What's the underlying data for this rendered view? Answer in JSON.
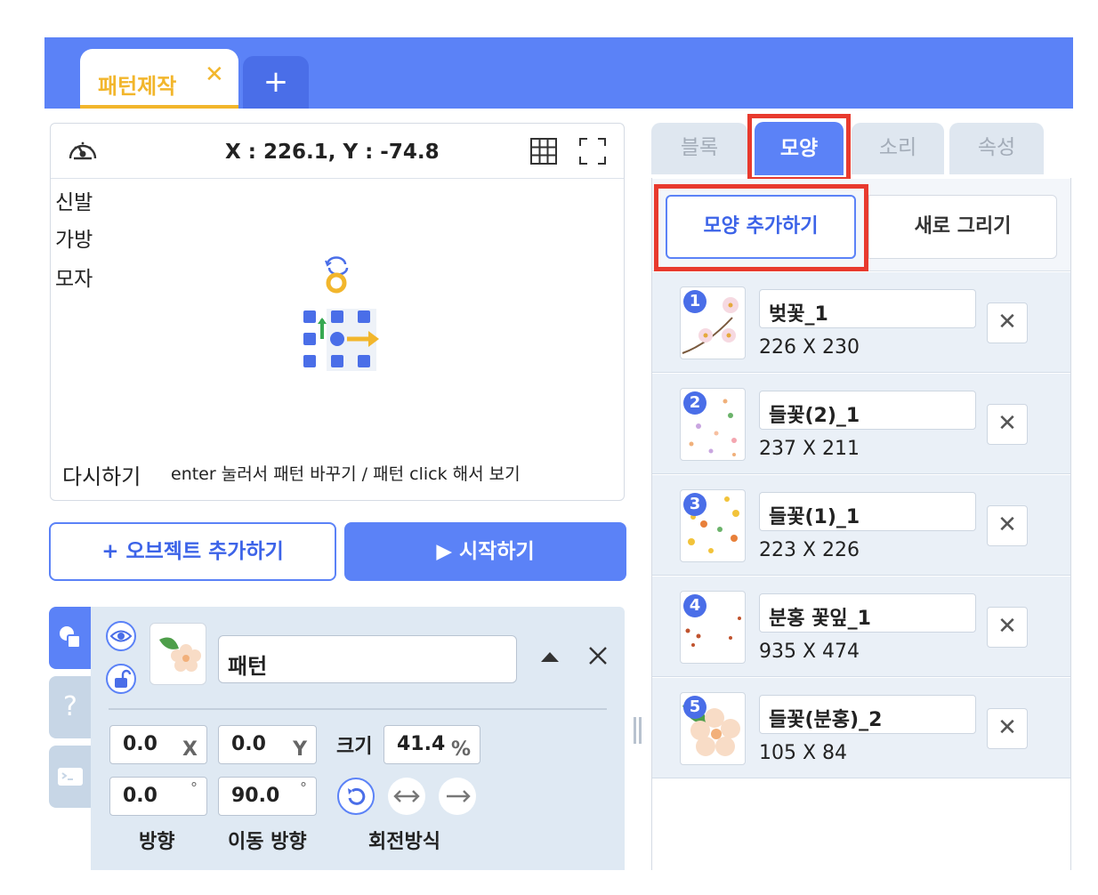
{
  "top_tabs": {
    "active_label": "패턴제작",
    "close_glyph": "✕",
    "add_glyph": "+"
  },
  "stage": {
    "coordinates": "X : 226.1, Y : -74.8",
    "labels": [
      "신발",
      "가방",
      "모자"
    ],
    "reset_label": "다시하기",
    "hint": "enter 눌러서 패턴 바꾸기 / 패턴 click 해서 보기"
  },
  "buttons": {
    "add_object": "+ 오브젝트 추가하기",
    "start": "▶ 시작하기"
  },
  "object": {
    "name": "패턴",
    "x": "0.0",
    "x_unit": "X",
    "y": "0.0",
    "y_unit": "Y",
    "size_label": "크기",
    "size": "41.4",
    "size_unit": "%",
    "direction": "0.0",
    "move_direction": "90.0",
    "degree": "°",
    "direction_label": "방향",
    "move_direction_label": "이동 방향",
    "rotation_label": "회전방식",
    "help_glyph": "?"
  },
  "right_panel": {
    "tabs": [
      "블록",
      "모양",
      "소리",
      "속성"
    ],
    "add_shape": "모양 추가하기",
    "new_draw": "새로 그리기",
    "shapes": [
      {
        "num": "1",
        "name": "벚꽃_1",
        "size": "226 X 230"
      },
      {
        "num": "2",
        "name": "들꽃(2)_1",
        "size": "237 X 211"
      },
      {
        "num": "3",
        "name": "들꽃(1)_1",
        "size": "223 X 226"
      },
      {
        "num": "4",
        "name": "분홍 꽃잎_1",
        "size": "935 X 474"
      },
      {
        "num": "5",
        "name": "들꽃(분홍)_2",
        "size": "105 X 84"
      }
    ],
    "delete_glyph": "✕"
  },
  "colors": {
    "brand": "#5b82f7",
    "accent_yellow": "#f2b62c",
    "highlight_red": "#e83a2e"
  }
}
